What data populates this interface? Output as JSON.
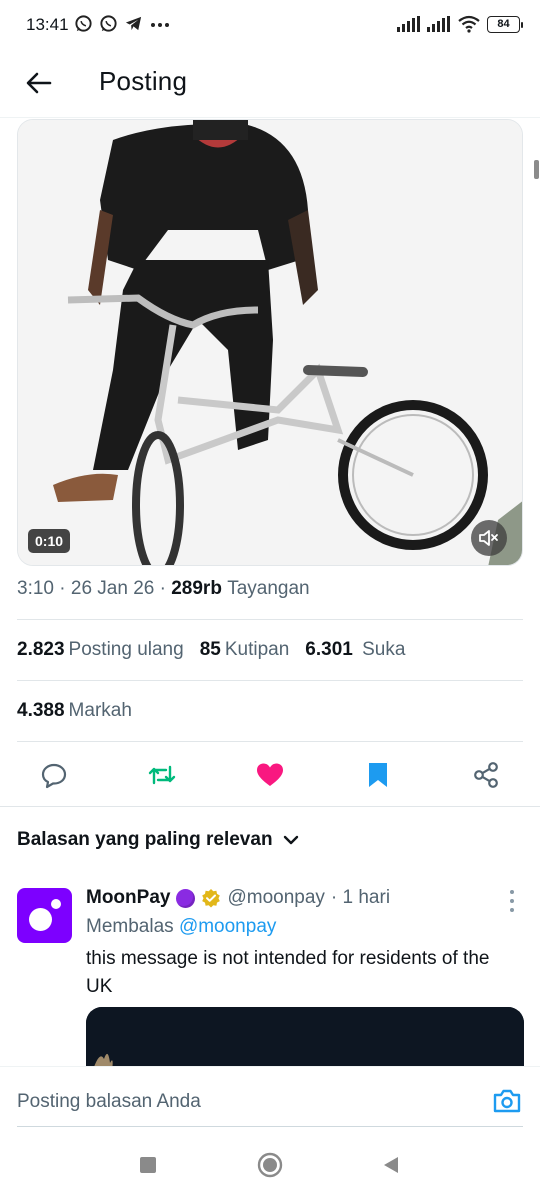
{
  "status_bar": {
    "time": "13:41",
    "notification_icons": [
      "whatsapp-icon",
      "whatsapp-icon",
      "telegram-icon",
      "more-dots-icon"
    ],
    "battery": "84"
  },
  "header": {
    "title": "Posting"
  },
  "video": {
    "duration": "0:10"
  },
  "meta": {
    "time": "3:10",
    "separator": " · ",
    "date": "26 Jan 26",
    "views_count": "289rb",
    "views_label": "Tayangan"
  },
  "stats": {
    "reposts_count": "2.823",
    "reposts_label": "Posting ulang",
    "quotes_count": "85",
    "quotes_label": "Kutipan",
    "likes_count": "6.301",
    "likes_label": "Suka",
    "bookmarks_count": "4.388",
    "bookmarks_label": "Markah"
  },
  "actions": [
    {
      "name": "reply-icon",
      "color": "#536471"
    },
    {
      "name": "repost-icon",
      "color": "#00ba7c"
    },
    {
      "name": "like-icon",
      "color": "#f91880"
    },
    {
      "name": "bookmark-icon",
      "color": "#1d9bf0"
    },
    {
      "name": "share-icon",
      "color": "#536471"
    }
  ],
  "replies_sort": {
    "label": "Balasan yang paling relevan"
  },
  "reply": {
    "author_name": "MoonPay",
    "handle": "@moonpay",
    "time": "· 1 hari",
    "replying_prefix": "Membalas",
    "replying_handle": "@moonpay",
    "text": "this message is not intended for residents of the UK",
    "avatar_color": "#7d00ff"
  },
  "compose": {
    "placeholder": "Posting balasan Anda"
  },
  "colors": {
    "accent_blue": "#1d9bf0",
    "secondary_text": "#536471"
  }
}
